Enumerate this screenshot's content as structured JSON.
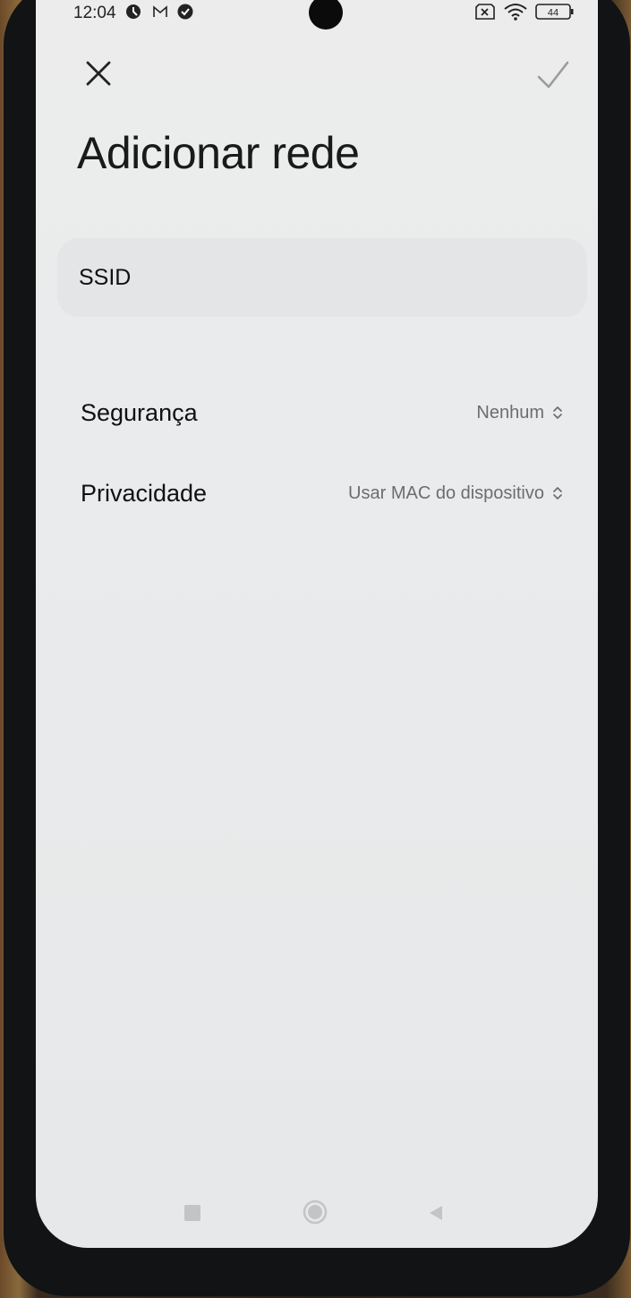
{
  "statusbar": {
    "time": "12:04",
    "battery": "44",
    "icons": [
      "data-saver-icon",
      "gmail-icon",
      "check-circle-icon",
      "no-sim-icon",
      "wifi-icon",
      "battery-icon"
    ]
  },
  "toolbar": {
    "close_icon": "close-icon",
    "confirm_icon": "check-icon"
  },
  "page": {
    "title": "Adicionar rede"
  },
  "ssid": {
    "placeholder": "SSID",
    "value": ""
  },
  "settings": [
    {
      "label": "Segurança",
      "value": "Nenhum"
    },
    {
      "label": "Privacidade",
      "value": "Usar MAC do dispositivo"
    }
  ],
  "navbar": {
    "icons": [
      "recents-icon",
      "home-icon",
      "back-icon"
    ]
  },
  "colors": {
    "background": "#ececec",
    "field": "#e4e5e6",
    "text": "#111111",
    "secondary_text": "#6b6d70"
  }
}
